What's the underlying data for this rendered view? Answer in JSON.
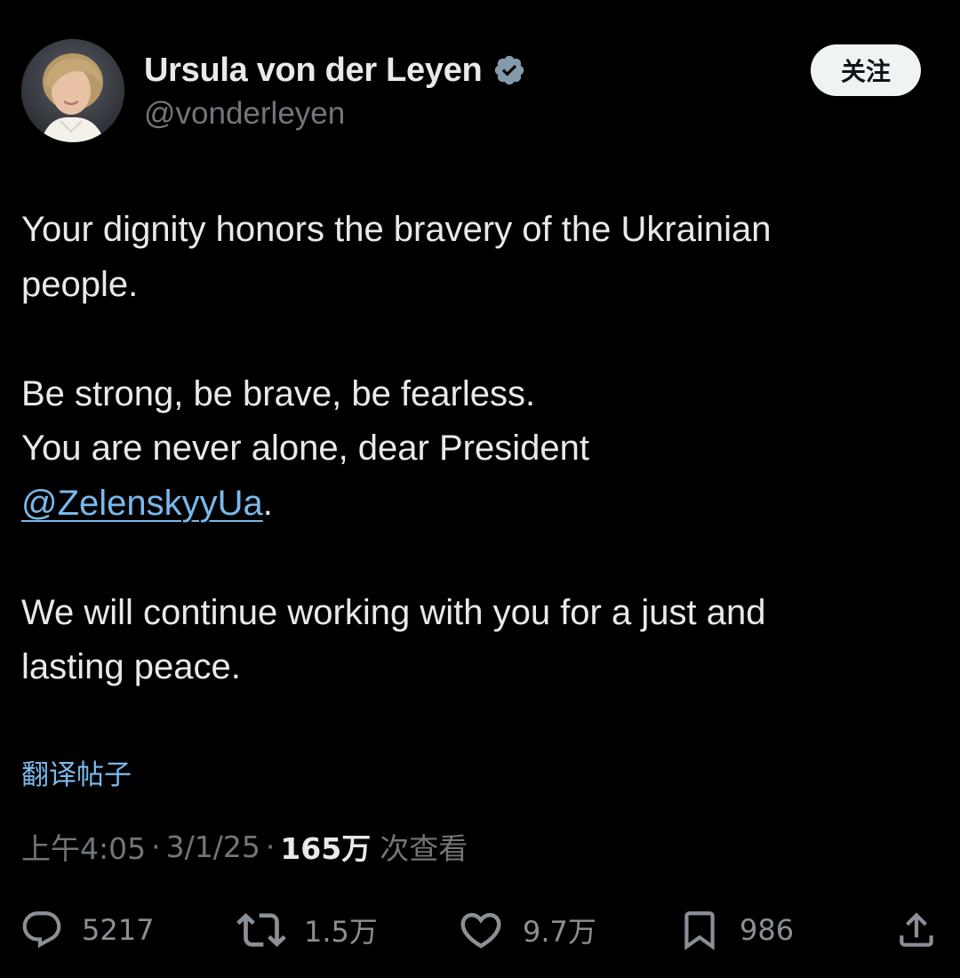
{
  "author": {
    "display_name": "Ursula von der Leyen",
    "handle": "@vonderleyen",
    "verified_icon": "verified-badge-icon",
    "avatar_icon": "profile-photo"
  },
  "follow_button": {
    "label": "关注"
  },
  "post": {
    "line1": "Your dignity honors the bravery of the Ukrainian",
    "line2": "people.",
    "line3": "Be strong, be brave, be fearless.",
    "line4": "You are never alone, dear President",
    "mention": "@ZelenskyyUa",
    "mention_suffix": ".",
    "line5": "We will continue working with you for a just and",
    "line6": "lasting peace."
  },
  "translate_link": "翻译帖子",
  "meta": {
    "time": "上午4:05",
    "separator": "·",
    "date": "3/1/25",
    "views_count": "165万",
    "views_label": "次查看"
  },
  "actions": {
    "reply": {
      "icon": "reply-icon",
      "count": "5217"
    },
    "repost": {
      "icon": "repost-icon",
      "count": "1.5万"
    },
    "like": {
      "icon": "heart-icon",
      "count": "9.7万"
    },
    "bookmark": {
      "icon": "bookmark-icon",
      "count": "986"
    },
    "share": {
      "icon": "share-icon"
    }
  },
  "colors": {
    "background": "#000000",
    "text_primary": "#e7e9ea",
    "text_secondary": "#71767b",
    "link": "#7ab8ea",
    "follow_button_bg": "#eff3f4"
  }
}
